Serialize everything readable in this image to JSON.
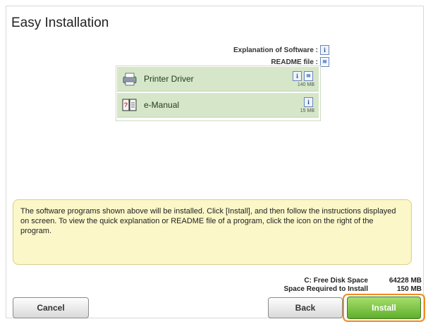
{
  "window": {
    "title": "Easy Installation"
  },
  "legend": {
    "explanation_label": "Explanation of Software :",
    "explanation_icon": "info-book-icon",
    "readme_label": "README file :",
    "readme_icon": "readme-document-icon"
  },
  "programs": [
    {
      "label": "Printer Driver",
      "icon": "printer-icon",
      "size": "140 MB"
    },
    {
      "label": "e-Manual",
      "icon": "manual-book-icon",
      "size": "15 MB"
    }
  ],
  "info_text": "The software programs shown above will be installed. Click [Install], and then follow the instructions displayed on screen. To view the quick explanation or README file of a program, click the icon on the right of the program.",
  "disk": {
    "free_label": "C: Free Disk Space",
    "free_value": "64228 MB",
    "required_label": "Space Required to Install",
    "required_value": "150 MB"
  },
  "buttons": {
    "cancel": "Cancel",
    "back": "Back",
    "install": "Install"
  },
  "colors": {
    "row_bg": "#d6e6c8",
    "info_bg": "#fbf7c8",
    "install_green": "#5fae2c",
    "highlight_orange": "#f08a22"
  }
}
